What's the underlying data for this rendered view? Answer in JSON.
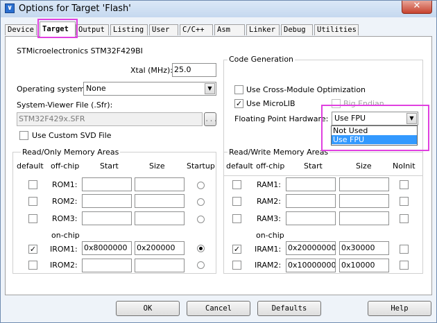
{
  "window": {
    "title": "Options for Target 'Flash'",
    "app_icon": "uv",
    "close_label": "✕"
  },
  "tabs": [
    "Device",
    "Target",
    "Output",
    "Listing",
    "User",
    "C/C++",
    "Asm",
    "Linker",
    "Debug",
    "Utilities"
  ],
  "active_tab": "Target",
  "device_name": "STMicroelectronics STM32F429BI",
  "xtal": {
    "label": "Xtal (MHz):",
    "value": "25.0"
  },
  "os": {
    "label": "Operating system:",
    "value": "None"
  },
  "svd": {
    "label": "System-Viewer File (.Sfr):",
    "value": "STM32F429x.SFR",
    "browse": "...",
    "custom_label": "Use Custom SVD File",
    "custom_checked": false
  },
  "codegen": {
    "title": "Code Generation",
    "cross_module": {
      "label": "Use Cross-Module Optimization",
      "checked": false
    },
    "microlib": {
      "label": "Use MicroLIB",
      "checked": true
    },
    "big_endian": {
      "label": "Big Endian",
      "checked": false
    },
    "fpu": {
      "label": "Floating Point Hardware:",
      "value": "Use FPU",
      "options": [
        "Not Used",
        "Use FPU"
      ],
      "selected": "Use FPU"
    }
  },
  "rom_group": {
    "title": "Read/Only Memory Areas",
    "headers": {
      "default": "default",
      "offchip": "off-chip",
      "start": "Start",
      "size": "Size",
      "startup": "Startup"
    },
    "onchip_label": "on-chip",
    "rows": [
      {
        "label": "ROM1:",
        "default": false,
        "start": "",
        "size": "",
        "startup": false
      },
      {
        "label": "ROM2:",
        "default": false,
        "start": "",
        "size": "",
        "startup": false
      },
      {
        "label": "ROM3:",
        "default": false,
        "start": "",
        "size": "",
        "startup": false
      },
      {
        "label": "IROM1:",
        "default": true,
        "start": "0x8000000",
        "size": "0x200000",
        "startup": true
      },
      {
        "label": "IROM2:",
        "default": false,
        "start": "",
        "size": "",
        "startup": false
      }
    ]
  },
  "ram_group": {
    "title": "Read/Write Memory Areas",
    "headers": {
      "default": "default",
      "offchip": "off-chip",
      "start": "Start",
      "size": "Size",
      "noinit": "NoInit"
    },
    "onchip_label": "on-chip",
    "rows": [
      {
        "label": "RAM1:",
        "default": false,
        "start": "",
        "size": "",
        "noinit": false
      },
      {
        "label": "RAM2:",
        "default": false,
        "start": "",
        "size": "",
        "noinit": false
      },
      {
        "label": "RAM3:",
        "default": false,
        "start": "",
        "size": "",
        "noinit": false
      },
      {
        "label": "IRAM1:",
        "default": true,
        "start": "0x20000000",
        "size": "0x30000",
        "noinit": false
      },
      {
        "label": "IRAM2:",
        "default": false,
        "start": "0x10000000",
        "size": "0x10000",
        "noinit": false
      }
    ]
  },
  "buttons": {
    "ok": "OK",
    "cancel": "Cancel",
    "defaults": "Defaults",
    "help": "Help"
  },
  "colors": {
    "highlight": "#e040e0",
    "selection": "#3399ff"
  }
}
